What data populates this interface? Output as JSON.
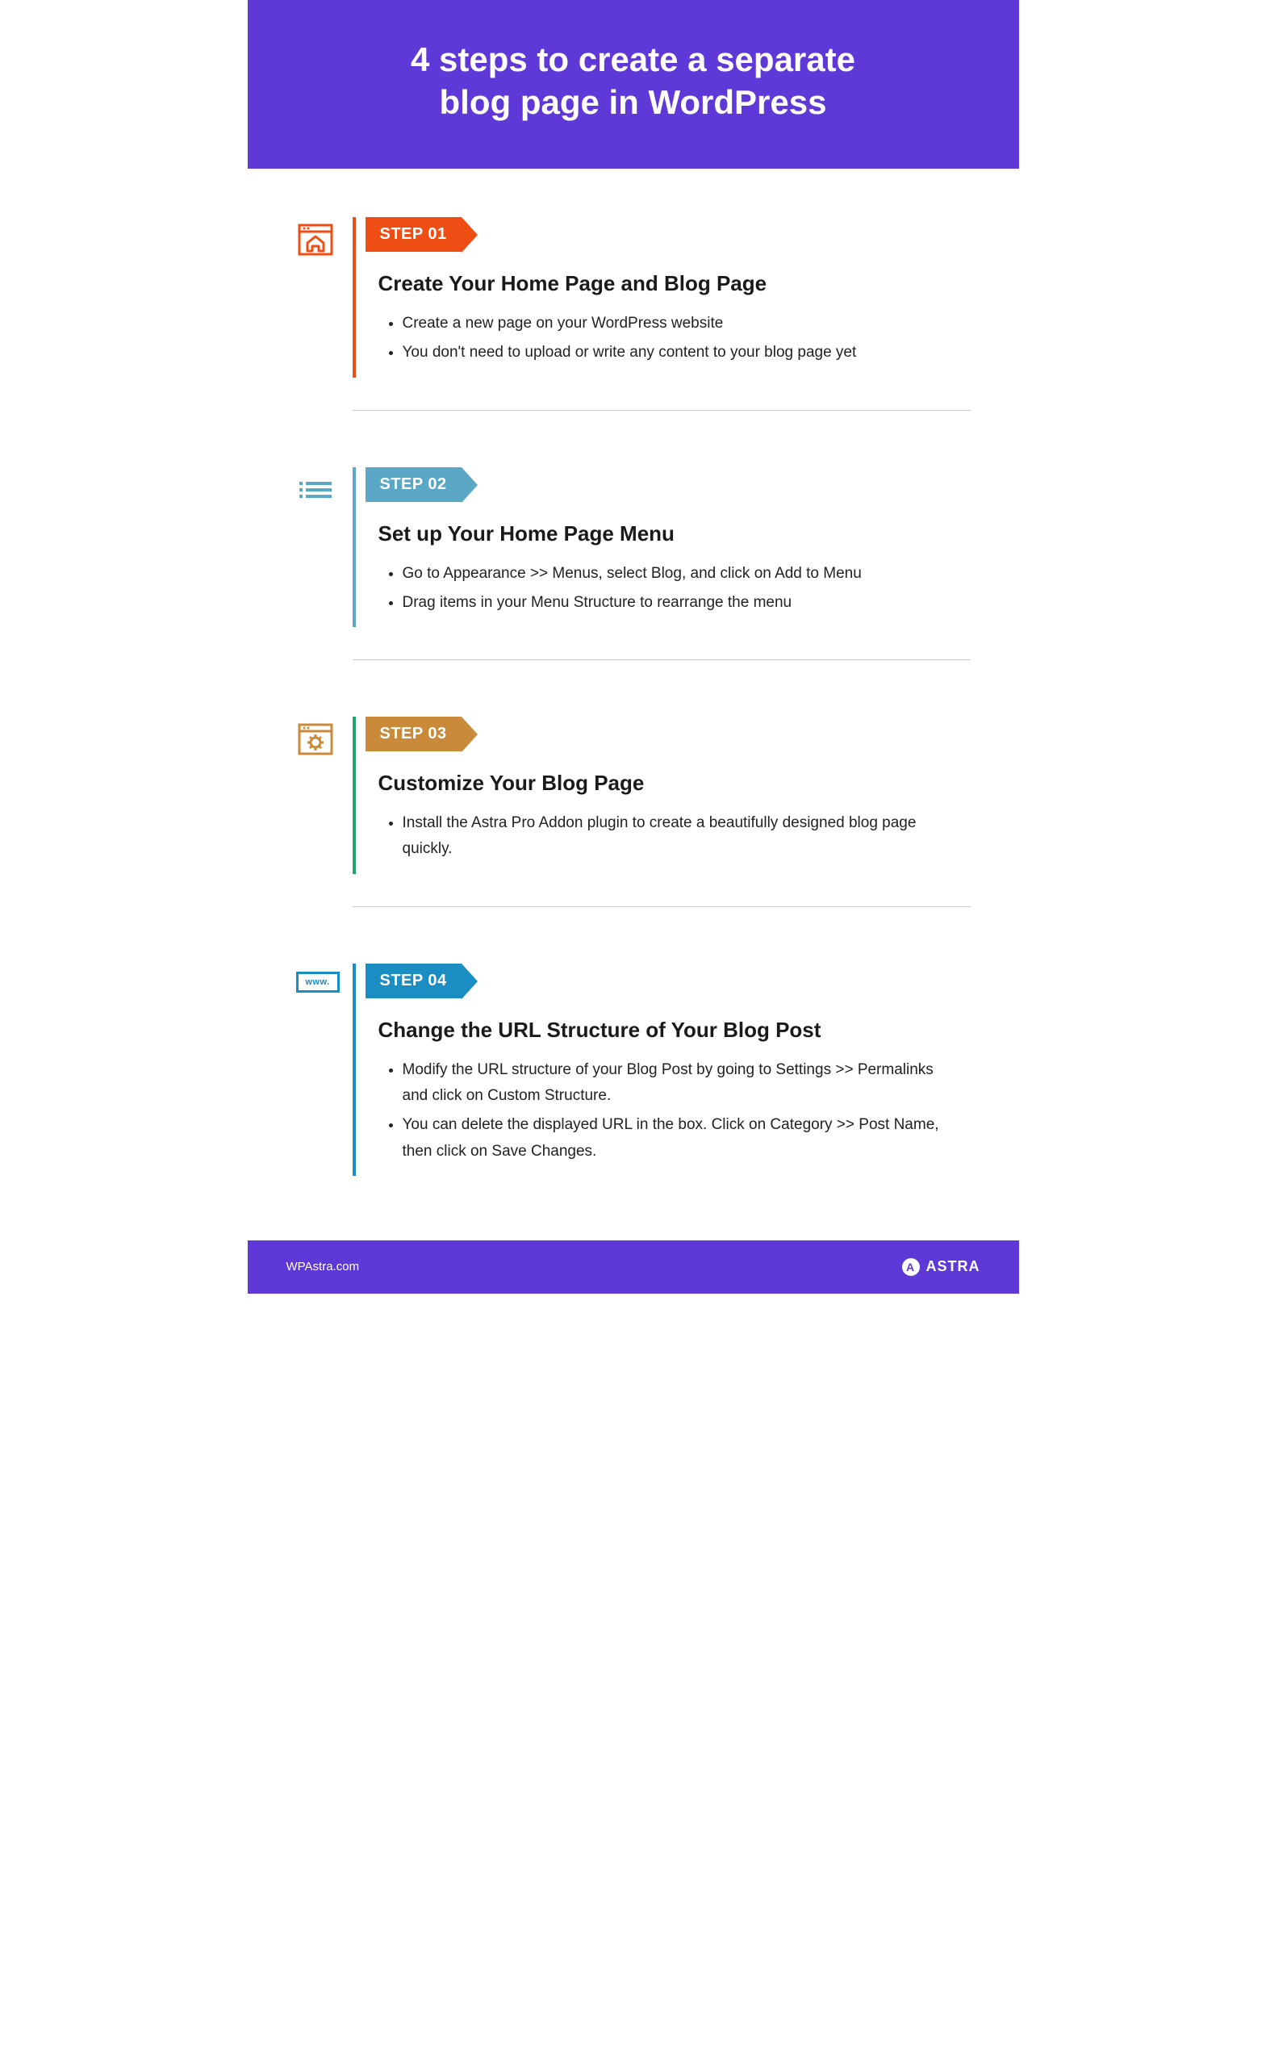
{
  "title_line1": "4 steps to create a separate",
  "title_line2": "blog page in WordPress",
  "steps": [
    {
      "badge": "STEP 01",
      "heading": "Create Your Home Page and Blog Page",
      "bullets": [
        "Create a new page on your WordPress website",
        "You don't need to upload or write any content to your blog page yet"
      ],
      "icon": "home-browser-icon",
      "badge_color": "#ee4e14",
      "border_color": "#ee4e14"
    },
    {
      "badge": "STEP 02",
      "heading": "Set up Your Home Page Menu",
      "bullets": [
        "Go to Appearance >> Menus, select Blog, and click on Add to Menu",
        "Drag items in your Menu Structure to rearrange the menu"
      ],
      "icon": "menu-lines-icon",
      "badge_color": "#5aa8c6",
      "border_color": "#5aa8c6"
    },
    {
      "badge": "STEP 03",
      "heading": "Customize Your Blog Page",
      "bullets": [
        "Install the Astra Pro Addon plugin to create a beautifully designed blog page quickly."
      ],
      "icon": "gear-browser-icon",
      "badge_color": "#c98b39",
      "border_color": "#22a36b"
    },
    {
      "badge": "STEP 04",
      "heading": "Change the URL Structure of Your Blog Post",
      "bullets": [
        "Modify the URL structure of your Blog Post by going to Settings >> Permalinks and click on Custom Structure.",
        "You can delete the displayed URL in the box. Click on Category >> Post Name, then click on Save Changes."
      ],
      "icon": "www-icon",
      "icon_text": "www.",
      "badge_color": "#1a8dc2",
      "border_color": "#1a8dc2"
    }
  ],
  "footer": {
    "site": "WPAstra.com",
    "brand": "ASTRA"
  }
}
